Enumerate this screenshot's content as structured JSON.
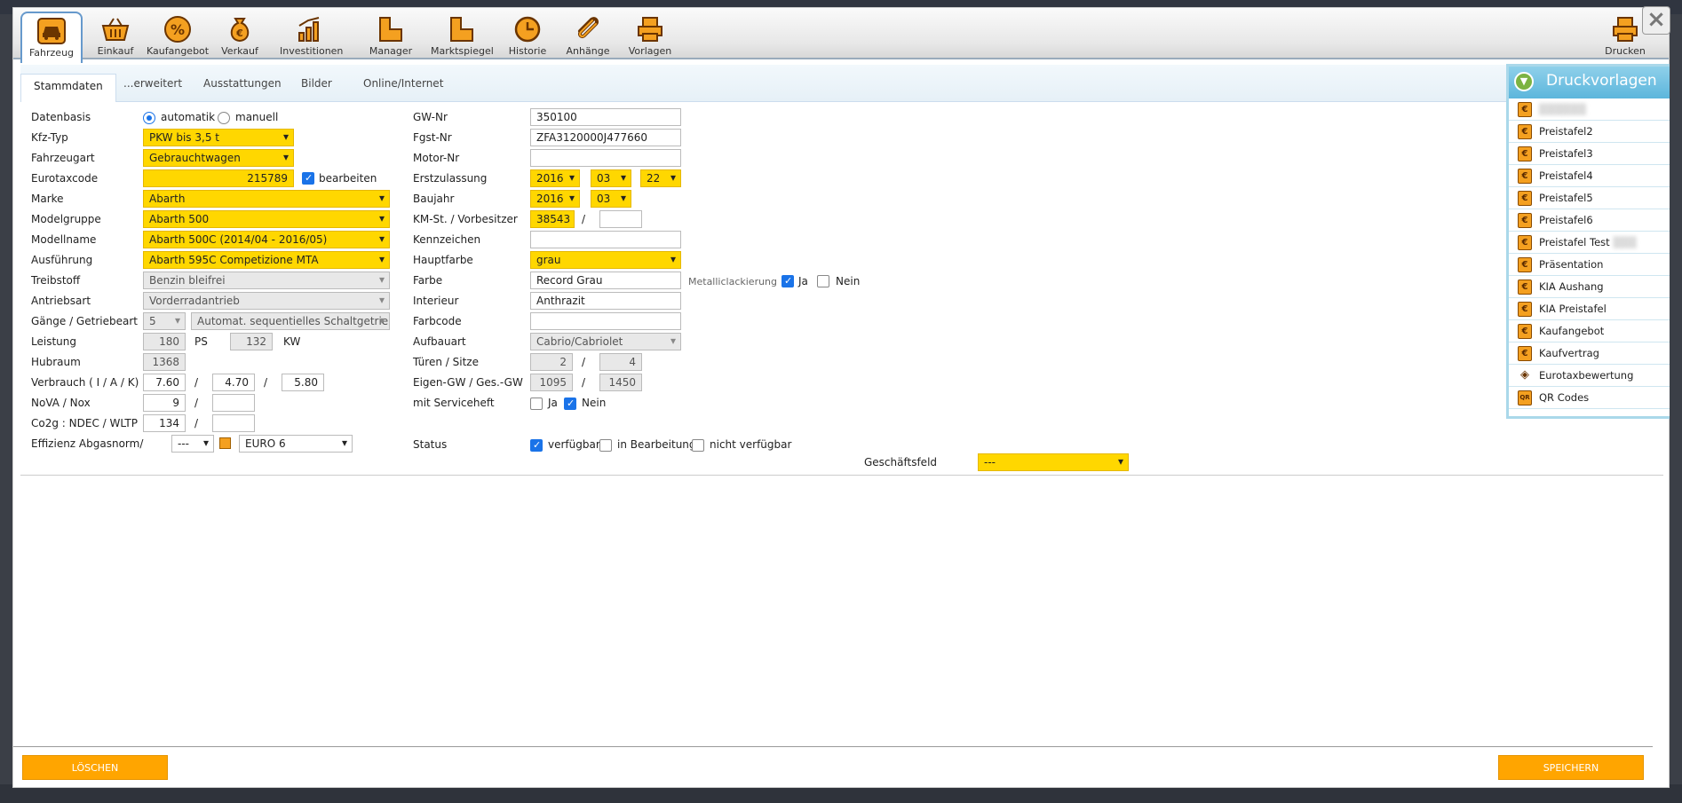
{
  "toolbar": {
    "tabs": [
      {
        "label": "Fahrzeug",
        "icon": "car-icon"
      },
      {
        "label": "Einkauf",
        "icon": "basket-icon"
      },
      {
        "label": "Kaufangebot",
        "icon": "percent-icon"
      },
      {
        "label": "Verkauf",
        "icon": "money-bag-icon"
      },
      {
        "label": "Investitionen",
        "icon": "bar-chart-icon"
      },
      {
        "label": "Manager",
        "icon": "step-icon"
      },
      {
        "label": "Marktspiegel",
        "icon": "step-icon"
      },
      {
        "label": "Historie",
        "icon": "clock-icon"
      },
      {
        "label": "Anhänge",
        "icon": "paperclip-icon"
      },
      {
        "label": "Vorlagen",
        "icon": "printer-icon"
      }
    ],
    "print_label": "Drucken",
    "close_glyph": "×"
  },
  "subtabs": [
    "Stammdaten",
    "...erweitert",
    "Ausstattungen",
    "Bilder",
    "Online/Internet"
  ],
  "left": {
    "datenbasis_label": "Datenbasis",
    "radio_auto": "automatik",
    "radio_manual": "manuell",
    "kfztyp_label": "Kfz-Typ",
    "kfztyp": "PKW bis 3,5 t",
    "fahrzeugart_label": "Fahrzeugart",
    "fahrzeugart": "Gebrauchtwagen",
    "eurotax_label": "Eurotaxcode",
    "eurotax": "215789",
    "bearbeiten": "bearbeiten",
    "marke_label": "Marke",
    "marke": "Abarth",
    "modelgruppe_label": "Modelgruppe",
    "modelgruppe": "Abarth 500",
    "modellname_label": "Modellname",
    "modellname": "Abarth 500C (2014/04 - 2016/05)",
    "ausfuehrung_label": "Ausführung",
    "ausfuehrung": "Abarth 595C Competizione MTA",
    "treibstoff_label": "Treibstoff",
    "treibstoff": "Benzin bleifrei",
    "antriebsart_label": "Antriebsart",
    "antriebsart": "Vorderradantrieb",
    "gaenge_label": "Gänge / Getriebeart",
    "gaenge": "5",
    "getriebe": "Automat. sequentielles Schaltgetriebe",
    "leistung_label": "Leistung",
    "ps": "180",
    "ps_unit": "PS",
    "kw": "132",
    "kw_unit": "KW",
    "hubraum_label": "Hubraum",
    "hubraum": "1368",
    "verbrauch_label": "Verbrauch ( I / A / K)",
    "v1": "7.60",
    "v2": "4.70",
    "v3": "5.80",
    "nova_label": "NoVA / Nox",
    "nova": "9",
    "nox": "",
    "co2_label": "Co2g : NDEC / WLTP",
    "co2": "134",
    "wltp": "",
    "effizienz_label": "Effizienz Abgasnorm/",
    "effizienz": "---",
    "abgasnorm": "EURO 6",
    "slash": "/"
  },
  "right": {
    "gwnr_label": "GW-Nr",
    "gwnr": "350100",
    "fgst_label": "Fgst-Nr",
    "fgst": "ZFA3120000J477660",
    "motor_label": "Motor-Nr",
    "motor": "",
    "erstzul_label": "Erstzulassung",
    "ez_y": "2016",
    "ez_m": "03",
    "ez_d": "22",
    "baujahr_label": "Baujahr",
    "bj_y": "2016",
    "bj_m": "03",
    "km_label": "KM-St. / Vorbesitzer",
    "km": "38543",
    "vorbesitzer": "",
    "kennzeichen_label": "Kennzeichen",
    "kennzeichen": "",
    "hauptfarbe_label": "Hauptfarbe",
    "hauptfarbe": "grau",
    "farbe_label": "Farbe",
    "farbe": "Record Grau",
    "metallic_label": "Metalliclackierung",
    "ja": "Ja",
    "nein": "Nein",
    "interieur_label": "Interieur",
    "interieur": "Anthrazit",
    "farbcode_label": "Farbcode",
    "farbcode": "",
    "aufbau_label": "Aufbauart",
    "aufbau": "Cabrio/Cabriolet",
    "tueren_label": "Türen / Sitze",
    "tueren": "2",
    "sitze": "4",
    "gewicht_label": "Eigen-GW / Ges.-GW",
    "eigen": "1095",
    "gesamt": "1450",
    "service_label": "mit Serviceheft",
    "status_label": "Status",
    "st1": "verfügbar",
    "st2": "in Bearbeitung",
    "st3": "nicht verfügbar",
    "geschaeft_label": "Geschäftsfeld",
    "geschaeft": "---"
  },
  "panel": {
    "title": "Druckvorlagen",
    "items": [
      {
        "label": "Preistafel2",
        "icon": "euro-doc-icon"
      },
      {
        "label": "Preistafel3",
        "icon": "euro-doc-icon"
      },
      {
        "label": "Preistafel4",
        "icon": "euro-doc-icon"
      },
      {
        "label": "Preistafel5",
        "icon": "euro-doc-icon"
      },
      {
        "label": "Preistafel6",
        "icon": "euro-doc-icon"
      },
      {
        "label": "Preistafel Test",
        "icon": "euro-doc-icon"
      },
      {
        "label": "Präsentation",
        "icon": "euro-doc-icon"
      },
      {
        "label": "KIA Aushang",
        "icon": "euro-doc-icon"
      },
      {
        "label": "KIA Preistafel",
        "icon": "euro-doc-icon"
      },
      {
        "label": "Kaufangebot",
        "icon": "euro-doc-icon"
      },
      {
        "label": "Kaufvertrag",
        "icon": "euro-doc-icon"
      },
      {
        "label": "Eurotaxbewertung",
        "icon": "eye-icon"
      },
      {
        "label": "QR Codes",
        "icon": "qr-icon"
      }
    ]
  },
  "footer": {
    "delete": "LÖSCHEN",
    "save": "SPEICHERN"
  },
  "colors": {
    "accent": "#ffd700",
    "button": "#ffa500",
    "tab_border": "#69c"
  }
}
